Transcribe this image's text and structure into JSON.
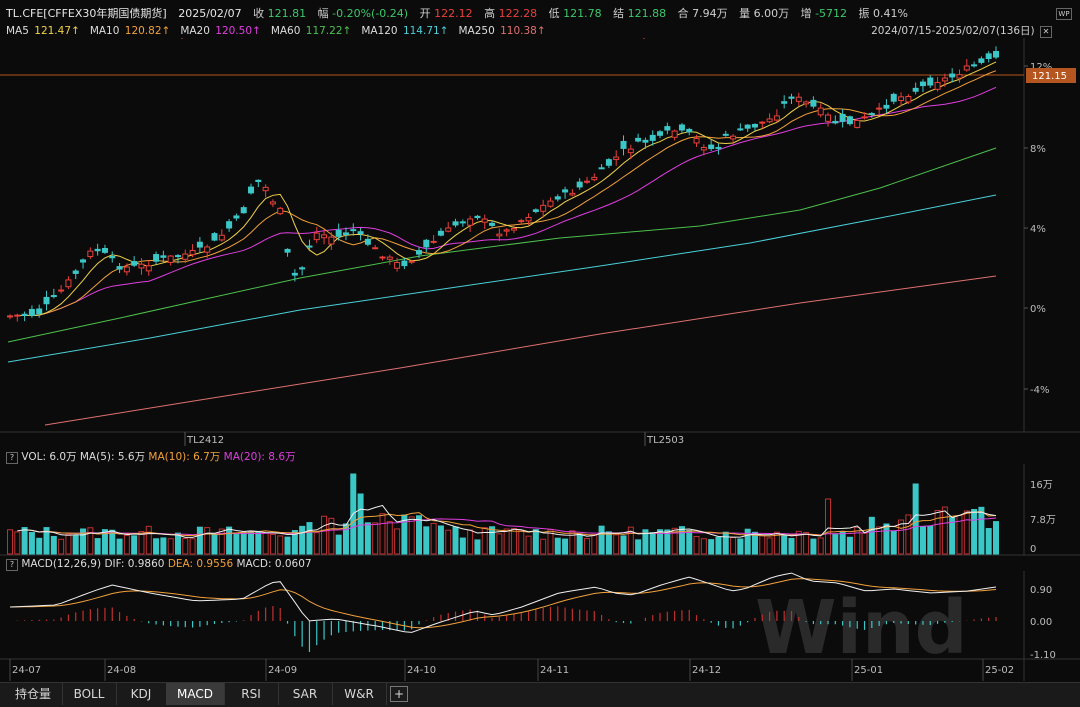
{
  "header": {
    "symbol": "TL.CFE[CFFEX30年期国债期货]",
    "date": "2025/02/07",
    "close_label": "收",
    "close_value": "121.81",
    "change_label": "幅",
    "change_value": "-0.20%(-0.24)",
    "open_label": "开",
    "open_value": "122.12",
    "high_label": "高",
    "high_value": "122.28",
    "low_label": "低",
    "low_value": "121.78",
    "settle_label": "结",
    "settle_value": "121.88",
    "amount_label": "合",
    "amount_value": "7.94万",
    "volume_label": "量",
    "volume_value": "6.00万",
    "oi_label": "增",
    "oi_value": "-5712",
    "amp_label": "振",
    "amp_value": "0.41%",
    "corner_icon": "WP"
  },
  "ma_legend": [
    {
      "label": "MA5",
      "value": "121.47↑",
      "color": "#f0d24a"
    },
    {
      "label": "MA10",
      "value": "120.82↑",
      "color": "#f2a13b"
    },
    {
      "label": "MA20",
      "value": "120.50↑",
      "color": "#e03ee0"
    },
    {
      "label": "MA60",
      "value": "117.22↑",
      "color": "#4cc04c"
    },
    {
      "label": "MA120",
      "value": "114.71↑",
      "color": "#4ad0d8"
    },
    {
      "label": "MA250",
      "value": "110.38↑",
      "color": "#e07070"
    }
  ],
  "range_text": "2024/07/15-2025/02/07(136日)",
  "price_badge": "121.15",
  "price_axis": [
    "12%",
    "8%",
    "4%",
    "0%",
    "-4%"
  ],
  "contract_labels": [
    "TL2412",
    "TL2503"
  ],
  "vol_header": {
    "q": "?",
    "vol": "VOL: 6.0万",
    "ma5": "MA(5): 5.6万",
    "ma10": "MA(10): 6.7万",
    "ma20": "MA(20): 8.6万"
  },
  "vol_axis": [
    "16万",
    "7.8万",
    "0"
  ],
  "macd_header": {
    "q": "?",
    "name": "MACD(12,26,9)",
    "dif": "DIF: 0.9860",
    "dea": "DEA: 0.9556",
    "macd": "MACD: 0.0607"
  },
  "macd_axis": [
    "0.90",
    "0.00",
    "-1.10"
  ],
  "date_axis": [
    "24-07",
    "24-08",
    "24-09",
    "24-10",
    "24-11",
    "24-12",
    "25-01",
    "25-02"
  ],
  "watermark": "Wind",
  "tabs": [
    "持仓量",
    "BOLL",
    "KDJ",
    "MACD",
    "RSI",
    "SAR",
    "W&R"
  ],
  "active_tab": "MACD",
  "add_tab": "+",
  "colors": {
    "up": "#e8403a",
    "down": "#3cc7c7",
    "bg": "#0b0b0b",
    "grid": "#2a2a2a",
    "dif": "#f0f0f0",
    "dea": "#f2a13b"
  },
  "chart_data": {
    "type": "candlestick",
    "title": "TL.CFE[CFFEX30年期国债期货]",
    "x_range": [
      "2024/07/15",
      "2025/02/07"
    ],
    "price_axis_percent": [
      12,
      8,
      4,
      0,
      -4
    ],
    "volume_axis": [
      "16万",
      "7.8万",
      "0"
    ],
    "macd_axis": [
      0.9,
      0.0,
      -1.1
    ],
    "last_close": 121.81,
    "ma": {
      "MA5": 121.47,
      "MA10": 120.82,
      "MA20": 120.5,
      "MA60": 117.22,
      "MA120": 114.71,
      "MA250": 110.38
    }
  }
}
